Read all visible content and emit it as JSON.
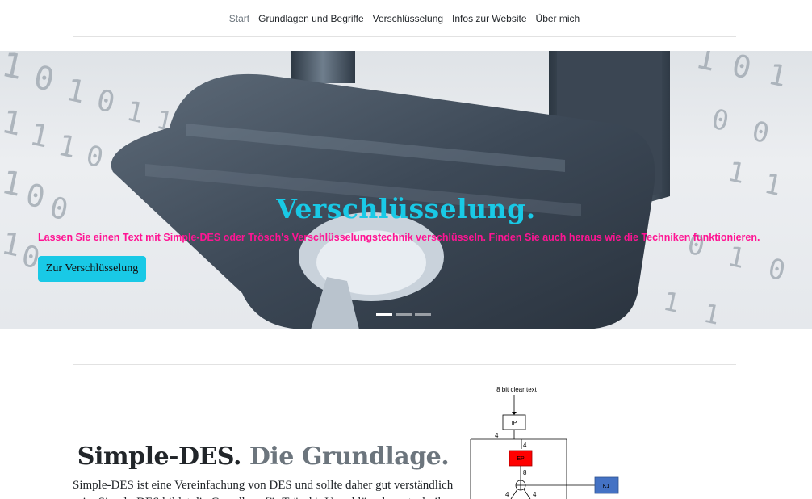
{
  "nav": {
    "items": [
      {
        "label": "Start",
        "active": true
      },
      {
        "label": "Grundlagen und Begriffe",
        "active": false
      },
      {
        "label": "Verschlüsselung",
        "active": false
      },
      {
        "label": "Infos zur Website",
        "active": false
      },
      {
        "label": "Über mich",
        "active": false
      }
    ]
  },
  "hero": {
    "title": "Verschlüsselung.",
    "subtitle": "Lassen Sie einen Text mit Simple-DES oder Trösch's Verschlüsselungstechnik verschlüsseln. Finden Sie auch heraus wie die Techniken funktionieren.",
    "button_label": "Zur Verschlüsselung",
    "background_digits": [
      "1",
      "0",
      "1",
      "0",
      "1",
      "1",
      "0",
      "1",
      "1",
      "1",
      "0",
      "1",
      "0",
      "0",
      "1",
      "0",
      "1",
      "0",
      "1",
      "0",
      "0",
      "1",
      "1",
      "0",
      "1",
      "0",
      "1",
      "1"
    ],
    "slides": 3,
    "active_slide": 0
  },
  "section": {
    "heading_main": "Simple-DES.",
    "heading_muted": "Die Grundlage.",
    "lead": "Simple-DES ist eine Vereinfachung von DES und sollte daher gut verständlich sein. Simple-DES bildet die Grundlage für Trösch's Verschlüsselungstechnik."
  },
  "diagram": {
    "input_label": "8 bit clear text",
    "ip_label": "IP",
    "ep_label": "EP",
    "k1_label": "K1",
    "label_4_left": "4",
    "label_4_right": "4",
    "label_8": "8",
    "label_4_bottom_left": "4",
    "label_4_bottom_right": "4"
  },
  "colors": {
    "accent": "#19c9e6",
    "subtitle": "#ff1493",
    "ep_box": "#ff0000",
    "k1_box": "#4472c4"
  }
}
